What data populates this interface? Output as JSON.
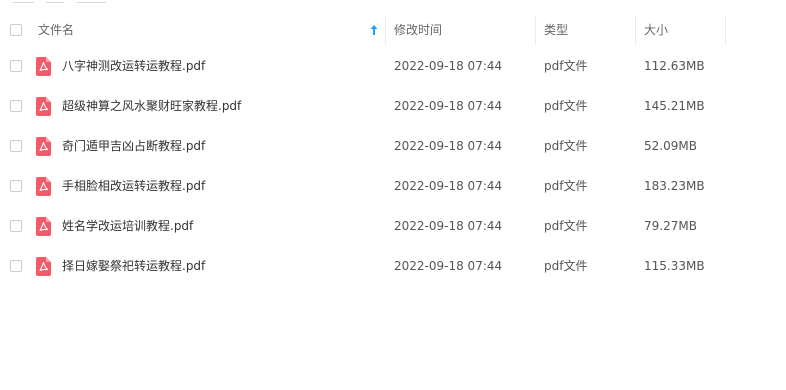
{
  "header": {
    "name_label": "文件名",
    "modified_label": "修改时间",
    "type_label": "类型",
    "size_label": "大小",
    "sort_icon": "sort-ascending-arrow-icon",
    "sort_color": "#1e9fff"
  },
  "files": [
    {
      "name": "八字神测改运转运教程.pdf",
      "modified": "2022-09-18 07:44",
      "type": "pdf文件",
      "size": "112.63MB",
      "icon": "pdf-file-icon"
    },
    {
      "name": "超级神算之风水聚财旺家教程.pdf",
      "modified": "2022-09-18 07:44",
      "type": "pdf文件",
      "size": "145.21MB",
      "icon": "pdf-file-icon"
    },
    {
      "name": "奇门遁甲吉凶占断教程.pdf",
      "modified": "2022-09-18 07:44",
      "type": "pdf文件",
      "size": "52.09MB",
      "icon": "pdf-file-icon"
    },
    {
      "name": "手相脸相改运转运教程.pdf",
      "modified": "2022-09-18 07:44",
      "type": "pdf文件",
      "size": "183.23MB",
      "icon": "pdf-file-icon"
    },
    {
      "name": "姓名学改运培训教程.pdf",
      "modified": "2022-09-18 07:44",
      "type": "pdf文件",
      "size": "79.27MB",
      "icon": "pdf-file-icon"
    },
    {
      "name": "择日嫁娶祭祀转运教程.pdf",
      "modified": "2022-09-18 07:44",
      "type": "pdf文件",
      "size": "115.33MB",
      "icon": "pdf-file-icon"
    }
  ],
  "colors": {
    "pdf_icon": "#ef5b6a"
  }
}
